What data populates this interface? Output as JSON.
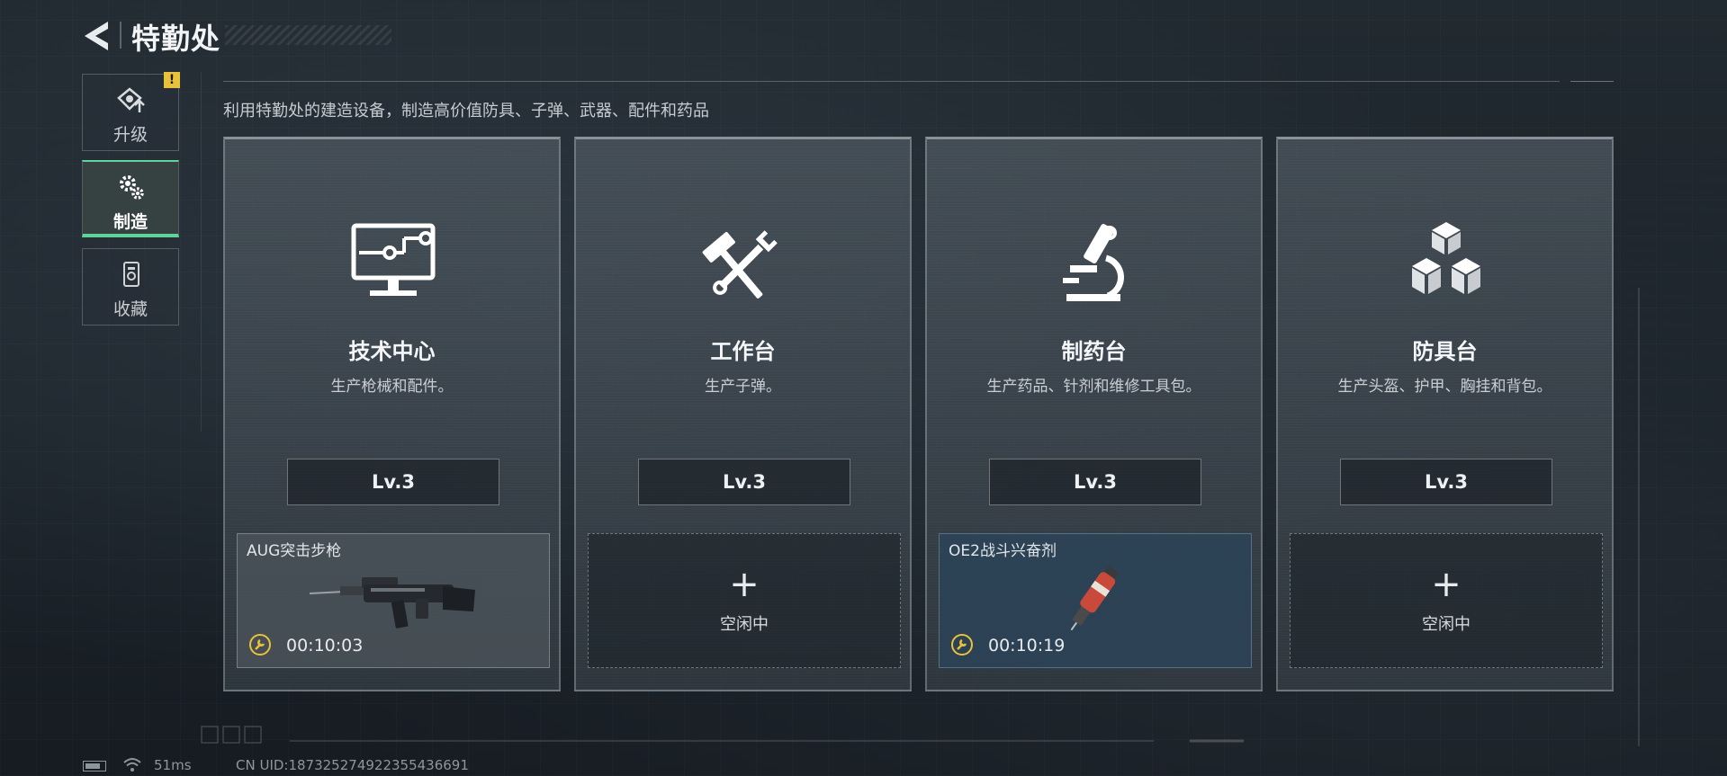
{
  "header": {
    "title": "特勤处"
  },
  "nav": {
    "items": [
      {
        "label": "升级",
        "icon": "upgrade-icon",
        "active": false,
        "alert": "!"
      },
      {
        "label": "制造",
        "icon": "craft-gears-icon",
        "active": true
      },
      {
        "label": "收藏",
        "icon": "collection-icon",
        "active": false
      }
    ]
  },
  "subtitle": "利用特勤处的建造设备，制造高价值防具、子弹、武器、配件和药品",
  "stations": [
    {
      "name": "技术中心",
      "desc": "生产枪械和配件。",
      "icon": "computer-monitor-icon",
      "level": "Lv.3",
      "slot": {
        "state": "active",
        "item": "AUG突击步枪",
        "timer": "00:10:03",
        "image": "rifle-icon"
      }
    },
    {
      "name": "工作台",
      "desc": "生产子弹。",
      "icon": "hammer-wrench-icon",
      "level": "Lv.3",
      "slot": {
        "state": "idle",
        "idle_label": "空闲中"
      }
    },
    {
      "name": "制药台",
      "desc": "生产药品、针剂和维修工具包。",
      "icon": "microscope-icon",
      "level": "Lv.3",
      "slot": {
        "state": "active",
        "item": "OE2战斗兴奋剂",
        "timer": "00:10:19",
        "image": "injector-icon"
      }
    },
    {
      "name": "防具台",
      "desc": "生产头盔、护甲、胸挂和背包。",
      "icon": "boxes-icon",
      "level": "Lv.3",
      "slot": {
        "state": "idle",
        "idle_label": "空闲中"
      }
    }
  ],
  "status": {
    "ping": "51ms",
    "uid": "CN UID:187325274922355436691"
  },
  "colors": {
    "accent_green": "#5fd39a",
    "alert_yellow": "#e8c23a",
    "timer_yellow": "#e8c23a"
  }
}
